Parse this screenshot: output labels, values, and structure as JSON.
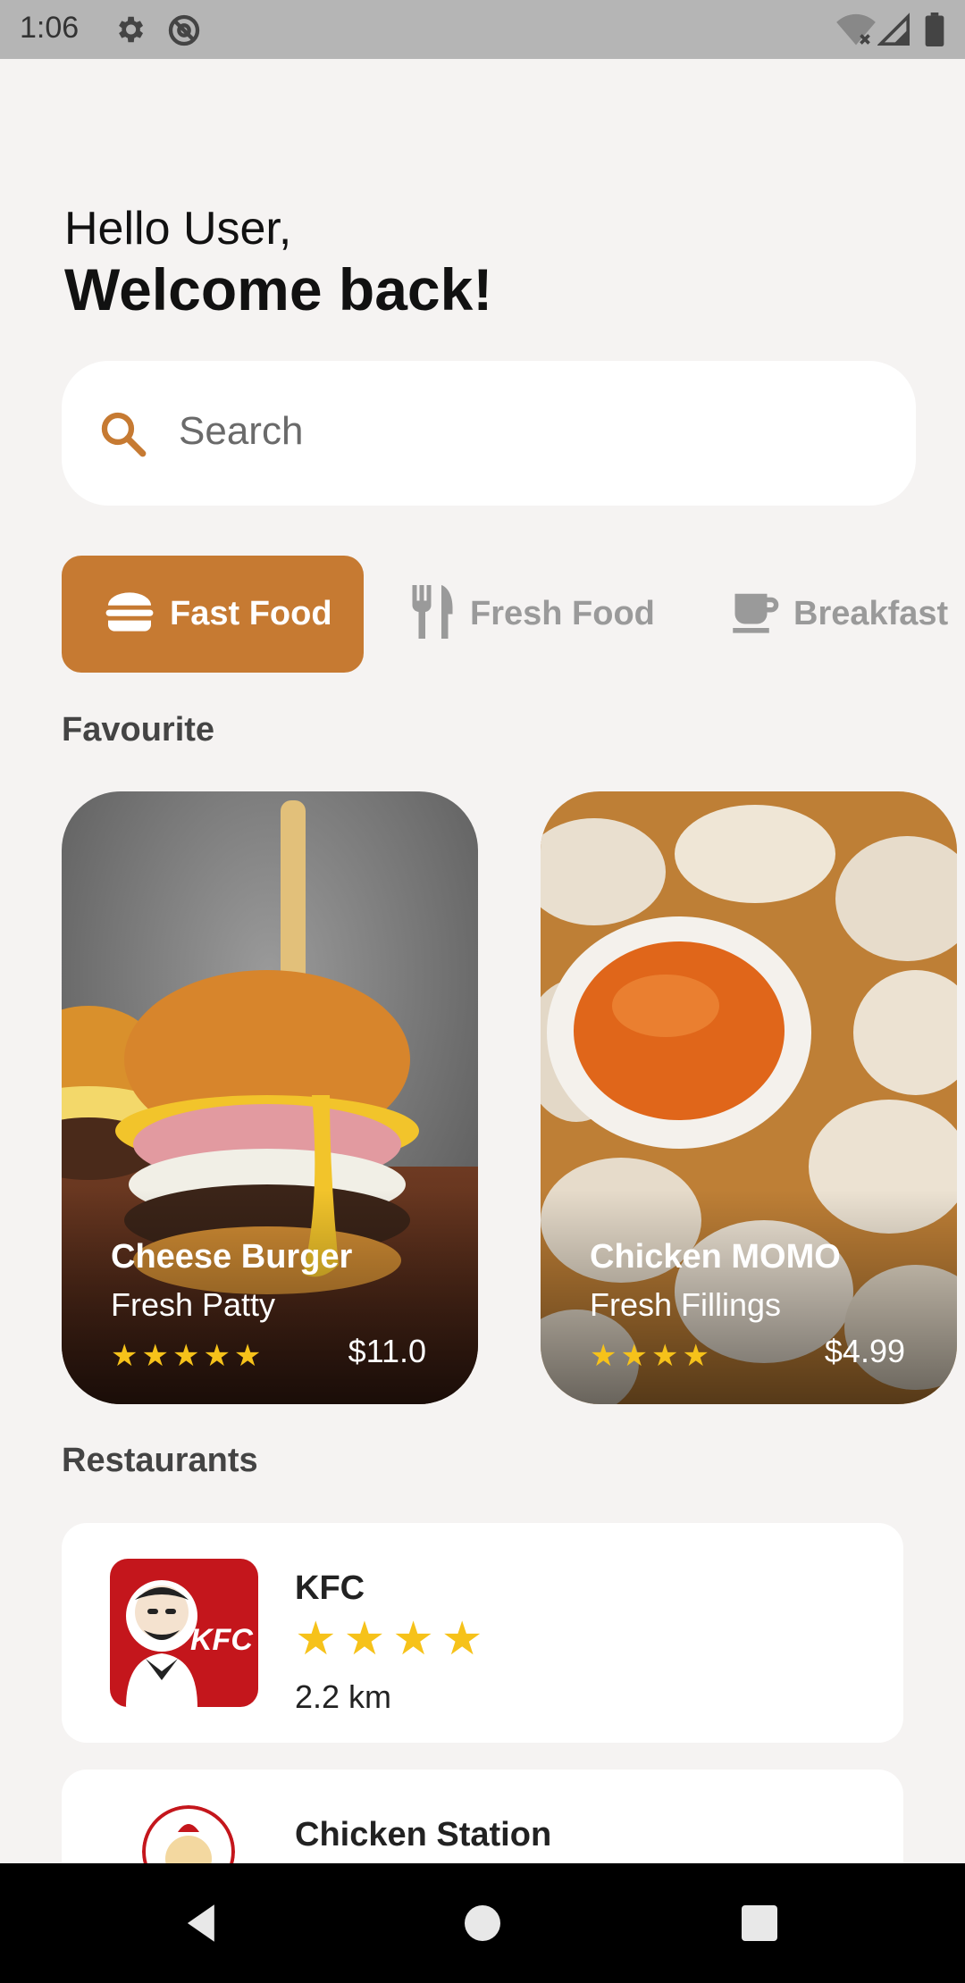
{
  "status_bar": {
    "time": "1:06",
    "icons": [
      "gear-icon",
      "at-sign-icon",
      "wifi-off-icon",
      "signal-icon",
      "battery-icon"
    ]
  },
  "greeting": {
    "line1": "Hello User,",
    "line2": "Welcome back!"
  },
  "search": {
    "placeholder": "Search",
    "icon": "search-icon"
  },
  "categories": [
    {
      "label": "Fast Food",
      "icon": "burger-icon",
      "active": true
    },
    {
      "label": "Fresh Food",
      "icon": "fork-knife-icon",
      "active": false
    },
    {
      "label": "Breakfast",
      "icon": "coffee-cup-icon",
      "active": false
    }
  ],
  "favourite": {
    "title": "Favourite",
    "items": [
      {
        "name": "Cheese Burger",
        "subtitle": "Fresh Patty",
        "rating": 5,
        "stars": "★★★★★",
        "price": "$11.0"
      },
      {
        "name": "Chicken MOMO",
        "subtitle": "Fresh Fillings",
        "rating": 4,
        "stars": "★★★★",
        "price": "$4.99"
      }
    ]
  },
  "restaurants": {
    "title": "Restaurants",
    "items": [
      {
        "name": "KFC",
        "rating": 4,
        "stars": "★★★★",
        "distance": "2.2 km"
      },
      {
        "name": "Chicken Station"
      }
    ]
  },
  "colors": {
    "accent": "#c67a32",
    "star": "#f6c21a",
    "background": "#f5f3f2"
  },
  "nav": [
    "back-icon",
    "home-icon",
    "recents-icon"
  ]
}
